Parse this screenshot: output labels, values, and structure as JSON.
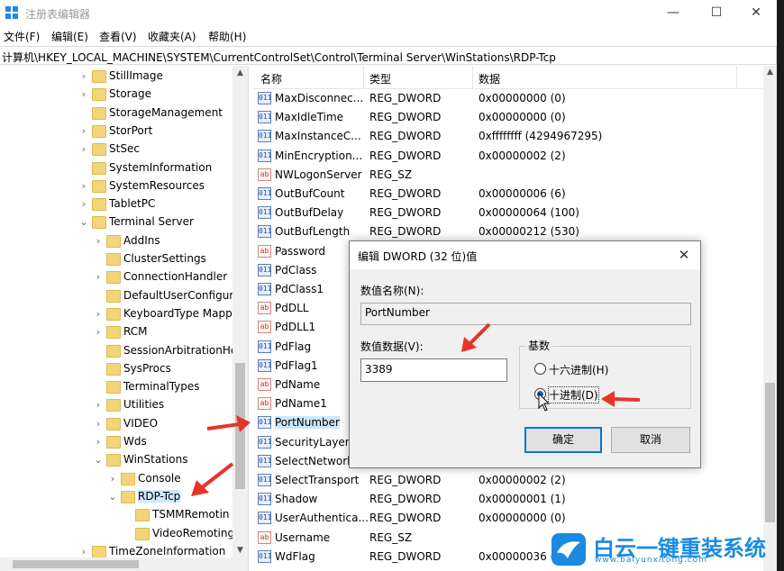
{
  "window": {
    "title": "注册表编辑器",
    "minimize": "—",
    "maximize": "☐",
    "close": "✕"
  },
  "menu": [
    "文件(F)",
    "编辑(E)",
    "查看(V)",
    "收藏夹(A)",
    "帮助(H)"
  ],
  "address": "计算机\\HKEY_LOCAL_MACHINE\\SYSTEM\\CurrentControlSet\\Control\\Terminal Server\\WinStations\\RDP-Tcp",
  "tree": [
    {
      "label": "StillImage",
      "level": 1,
      "expander": "›"
    },
    {
      "label": "Storage",
      "level": 1,
      "expander": "›"
    },
    {
      "label": "StorageManagement",
      "level": 1,
      "expander": ""
    },
    {
      "label": "StorPort",
      "level": 1,
      "expander": "›"
    },
    {
      "label": "StSec",
      "level": 1,
      "expander": "›"
    },
    {
      "label": "SystemInformation",
      "level": 1,
      "expander": ""
    },
    {
      "label": "SystemResources",
      "level": 1,
      "expander": "›"
    },
    {
      "label": "TabletPC",
      "level": 1,
      "expander": "›"
    },
    {
      "label": "Terminal Server",
      "level": 1,
      "expander": "⌄"
    },
    {
      "label": "AddIns",
      "level": 2,
      "expander": "›"
    },
    {
      "label": "ClusterSettings",
      "level": 2,
      "expander": ""
    },
    {
      "label": "ConnectionHandler",
      "level": 2,
      "expander": "›"
    },
    {
      "label": "DefaultUserConfigur",
      "level": 2,
      "expander": ""
    },
    {
      "label": "KeyboardType Mapp",
      "level": 2,
      "expander": "›"
    },
    {
      "label": "RCM",
      "level": 2,
      "expander": "›"
    },
    {
      "label": "SessionArbitrationHe",
      "level": 2,
      "expander": ""
    },
    {
      "label": "SysProcs",
      "level": 2,
      "expander": ""
    },
    {
      "label": "TerminalTypes",
      "level": 2,
      "expander": ""
    },
    {
      "label": "Utilities",
      "level": 2,
      "expander": "›"
    },
    {
      "label": "VIDEO",
      "level": 2,
      "expander": "›"
    },
    {
      "label": "Wds",
      "level": 2,
      "expander": "›"
    },
    {
      "label": "WinStations",
      "level": 2,
      "expander": "⌄"
    },
    {
      "label": "Console",
      "level": 3,
      "expander": "›"
    },
    {
      "label": "RDP-Tcp",
      "level": 3,
      "expander": "⌄",
      "selected": true
    },
    {
      "label": "TSMMRemotin",
      "level": 4,
      "expander": ""
    },
    {
      "label": "VideoRemoting",
      "level": 4,
      "expander": ""
    },
    {
      "label": "TimeZoneInformation",
      "level": 1,
      "expander": "›"
    }
  ],
  "list": {
    "headers": [
      "名称",
      "类型",
      "数据"
    ],
    "rows": [
      {
        "name": "MaxDisconnec...",
        "type": "REG_DWORD",
        "data": "0x00000000 (0)",
        "icon": "bin"
      },
      {
        "name": "MaxIdleTime",
        "type": "REG_DWORD",
        "data": "0x00000000 (0)",
        "icon": "bin"
      },
      {
        "name": "MaxInstanceC...",
        "type": "REG_DWORD",
        "data": "0xffffffff (4294967295)",
        "icon": "bin"
      },
      {
        "name": "MinEncryption...",
        "type": "REG_DWORD",
        "data": "0x00000002 (2)",
        "icon": "bin"
      },
      {
        "name": "NWLogonServer",
        "type": "REG_SZ",
        "data": "",
        "icon": "str"
      },
      {
        "name": "OutBufCount",
        "type": "REG_DWORD",
        "data": "0x00000006 (6)",
        "icon": "bin"
      },
      {
        "name": "OutBufDelay",
        "type": "REG_DWORD",
        "data": "0x00000064 (100)",
        "icon": "bin"
      },
      {
        "name": "OutBufLength",
        "type": "REG_DWORD",
        "data": "0x00000212 (530)",
        "icon": "bin"
      },
      {
        "name": "Password",
        "type": "",
        "data": "",
        "icon": "str"
      },
      {
        "name": "PdClass",
        "type": "",
        "data": "",
        "icon": "bin"
      },
      {
        "name": "PdClass1",
        "type": "",
        "data": "",
        "icon": "bin"
      },
      {
        "name": "PdDLL",
        "type": "",
        "data": "",
        "icon": "str"
      },
      {
        "name": "PdDLL1",
        "type": "",
        "data": "",
        "icon": "str"
      },
      {
        "name": "PdFlag",
        "type": "",
        "data": "",
        "icon": "bin"
      },
      {
        "name": "PdFlag1",
        "type": "",
        "data": "",
        "icon": "bin"
      },
      {
        "name": "PdName",
        "type": "",
        "data": "",
        "icon": "str"
      },
      {
        "name": "PdName1",
        "type": "",
        "data": "",
        "icon": "str"
      },
      {
        "name": "PortNumber",
        "type": "",
        "data": "",
        "icon": "bin",
        "selected": true
      },
      {
        "name": "SecurityLayer",
        "type": "",
        "data": "",
        "icon": "bin"
      },
      {
        "name": "SelectNetwork",
        "type": "",
        "data": "",
        "icon": "bin"
      },
      {
        "name": "SelectTransport",
        "type": "REG_DWORD",
        "data": "0x00000002 (2)",
        "icon": "bin"
      },
      {
        "name": "Shadow",
        "type": "REG_DWORD",
        "data": "0x00000001 (1)",
        "icon": "bin"
      },
      {
        "name": "UserAuthentica...",
        "type": "REG_DWORD",
        "data": "0x00000000 (0)",
        "icon": "bin"
      },
      {
        "name": "Username",
        "type": "REG_SZ",
        "data": "",
        "icon": "str"
      },
      {
        "name": "WdFlag",
        "type": "REG_DWORD",
        "data": "0x00000036 (5",
        "icon": "bin"
      }
    ]
  },
  "dialog": {
    "title": "编辑 DWORD (32 位)值",
    "close": "✕",
    "name_label": "数值名称(N):",
    "name_value": "PortNumber",
    "value_label": "数值数据(V):",
    "value_value": "3389",
    "base_label": "基数",
    "hex_label": "十六进制(H)",
    "dec_label": "十进制(D)",
    "base_selected": "decimal",
    "ok": "确定",
    "cancel": "取消"
  },
  "watermark": {
    "title": "白云一键重装系统",
    "url": "www.baiyunxitong.com"
  },
  "colors": {
    "accent": "#0078d7",
    "arrow": "#e8332a",
    "folder": "#f2d57a",
    "selection": "#cce8ff"
  }
}
